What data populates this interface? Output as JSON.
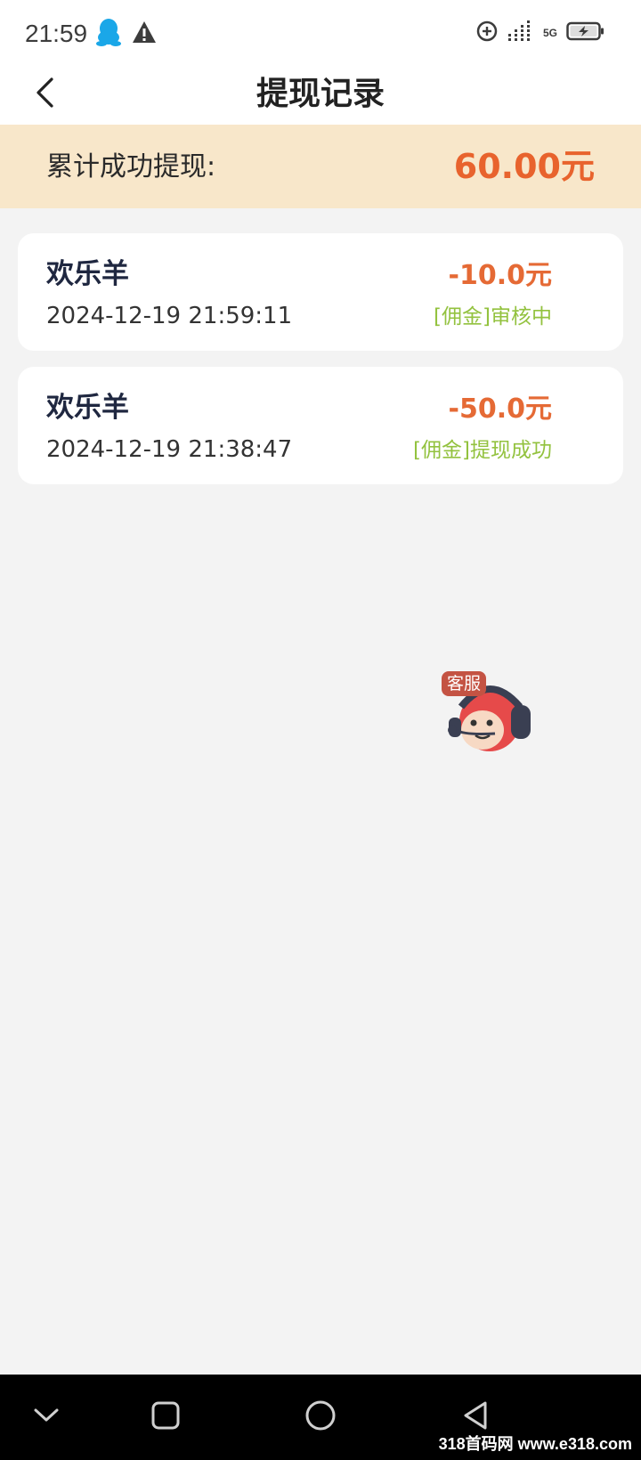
{
  "status_bar": {
    "time": "21:59",
    "network_label": "5G"
  },
  "header": {
    "title": "提现记录"
  },
  "summary": {
    "label": "累计成功提现:",
    "amount": "60.00元",
    "amount_color": "#e8632d",
    "background": "#f8e7ca"
  },
  "records": [
    {
      "name": "欢乐羊",
      "time": "2024-12-19 21:59:11",
      "amount": "-10.0元",
      "status": "[佣金]审核中"
    },
    {
      "name": "欢乐羊",
      "time": "2024-12-19 21:38:47",
      "amount": "-50.0元",
      "status": "[佣金]提现成功"
    }
  ],
  "customer_service": {
    "badge": "客服"
  },
  "watermark": "318首码网 www.e318.com",
  "colors": {
    "status_green": "#93c23f",
    "amount_orange": "#e56a35"
  }
}
